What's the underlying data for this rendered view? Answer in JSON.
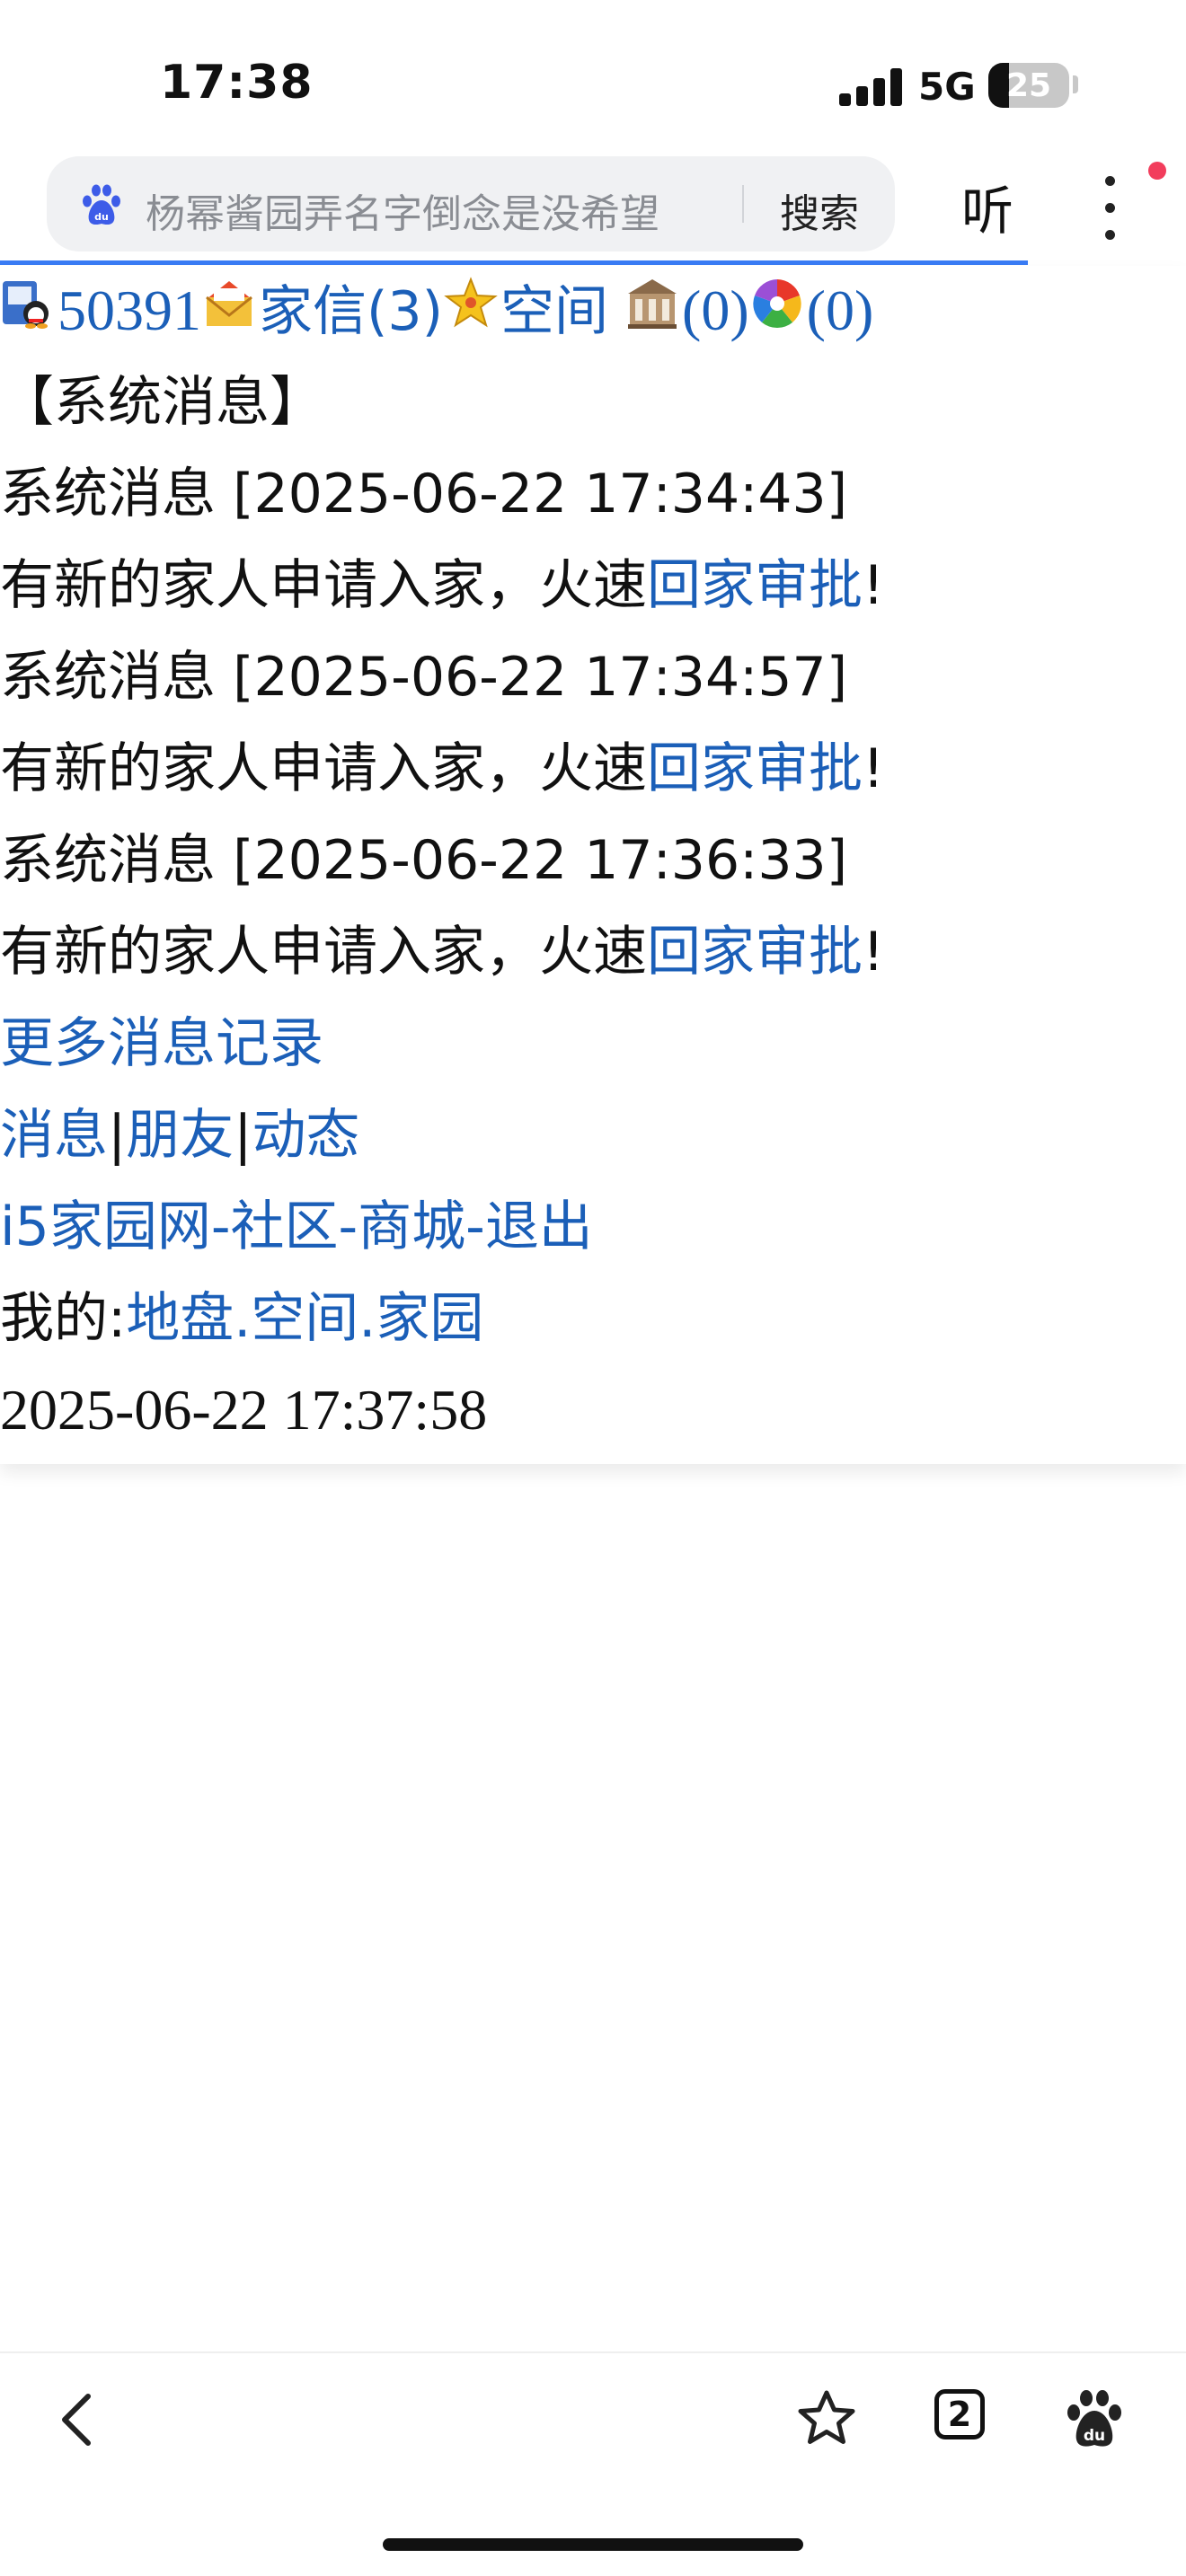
{
  "status_bar": {
    "time": "17:38",
    "network": "5G",
    "battery": "25",
    "battery_level": 0.25
  },
  "browser": {
    "search_text": "杨幂酱园弄名字倒念是没希望",
    "search_button": "搜索",
    "listen_button": "听",
    "icons": [
      "baidu-paw-icon",
      "more-vertical-icon"
    ]
  },
  "page": {
    "top_nav": {
      "user_id": "50391",
      "mail_label": "家信(3)",
      "space_label": "空间",
      "house_count": "(0)",
      "album_count": "(0)",
      "icons": [
        "qq-user-icon",
        "mail-envelope-icon",
        "star-space-icon",
        "building-icon",
        "pinwheel-icon"
      ]
    },
    "section_title": "【系统消息】",
    "messages": [
      {
        "header": "系统消息 [2025-06-22 17:34:43]",
        "body": "有新的家人申请入家，火速",
        "link": "回家审批",
        "end": "!"
      },
      {
        "header": "系统消息 [2025-06-22 17:34:57]",
        "body": "有新的家人申请入家，火速",
        "link": "回家审批",
        "end": "!"
      },
      {
        "header": "系统消息 [2025-06-22 17:36:33]",
        "body": "有新的家人申请入家，火速",
        "link": "回家审批",
        "end": "!"
      }
    ],
    "more_records": "更多消息记录",
    "nav_links": {
      "messages": "消息",
      "friends": "朋友",
      "feed": "动态",
      "sep": "|"
    },
    "site_links": {
      "home": "i5家园网",
      "community": "社区",
      "mall": "商城",
      "logout": "退出",
      "sep": "-"
    },
    "my_links": {
      "prefix": "我的:",
      "plot": "地盘",
      "space": "空间",
      "garden": "家园",
      "sep": "."
    },
    "timestamp": "2025-06-22 17:37:58"
  },
  "toolbar": {
    "tab_count": "2",
    "icons": [
      "back-chevron-icon",
      "star-bookmark-icon",
      "tab-count-icon",
      "baidu-paw-icon"
    ]
  },
  "colors": {
    "link": "#1b5fb8",
    "progress": "#3a7cf5",
    "notify_dot": "#f23d5c",
    "search_bg": "#f0f1f3"
  }
}
